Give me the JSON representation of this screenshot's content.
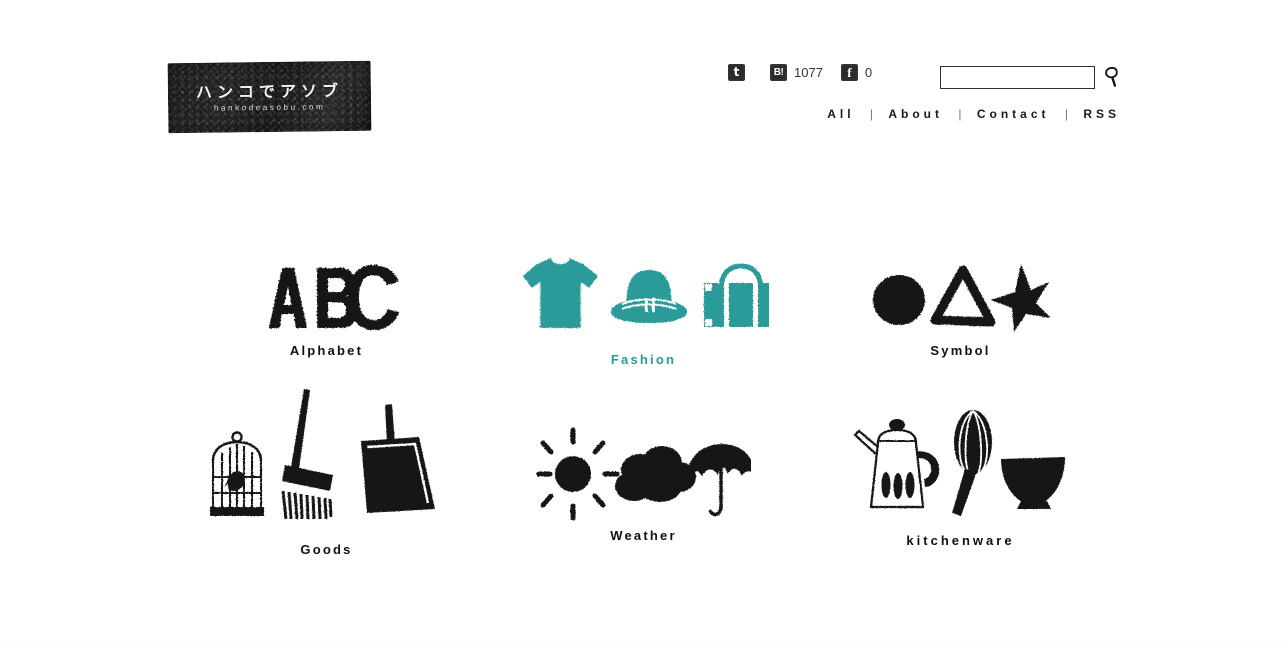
{
  "site": {
    "logo_jp": "ハンコでアソブ",
    "logo_url": "hankodeasobu.com"
  },
  "social": [
    {
      "id": "twitter",
      "icon": "twitter-icon",
      "glyph": "t",
      "count": ""
    },
    {
      "id": "hatena",
      "icon": "hatena-bookmark-icon",
      "glyph": "B!",
      "count": "1077"
    },
    {
      "id": "facebook",
      "icon": "facebook-icon",
      "glyph": "f",
      "count": "0"
    }
  ],
  "search": {
    "value": "",
    "placeholder": "",
    "button_icon": "search-icon"
  },
  "nav": {
    "items": [
      {
        "label": "All"
      },
      {
        "label": "About"
      },
      {
        "label": "Contact"
      },
      {
        "label": "RSS"
      }
    ],
    "separator": "|"
  },
  "categories": [
    {
      "label": "Alphabet",
      "icons": [
        "letter-a-stamp",
        "letter-b-stamp",
        "letter-c-stamp"
      ],
      "active": false
    },
    {
      "label": "Fashion",
      "icons": [
        "tshirt-stamp",
        "hat-stamp",
        "suitcase-stamp"
      ],
      "active": true
    },
    {
      "label": "Symbol",
      "icons": [
        "circle-stamp",
        "triangle-stamp",
        "star-stamp"
      ],
      "active": false
    },
    {
      "label": "Goods",
      "icons": [
        "birdcage-stamp",
        "broom-stamp",
        "dustpan-stamp"
      ],
      "active": false
    },
    {
      "label": "Weather",
      "icons": [
        "sun-stamp",
        "cloud-stamp",
        "umbrella-stamp"
      ],
      "active": false
    },
    {
      "label": "kitchenware",
      "icons": [
        "kettle-stamp",
        "whisk-stamp",
        "bowl-stamp"
      ],
      "active": false
    }
  ],
  "colors": {
    "ink": "#111111",
    "accent_teal": "#2a9b99",
    "background": "#ffffff"
  }
}
